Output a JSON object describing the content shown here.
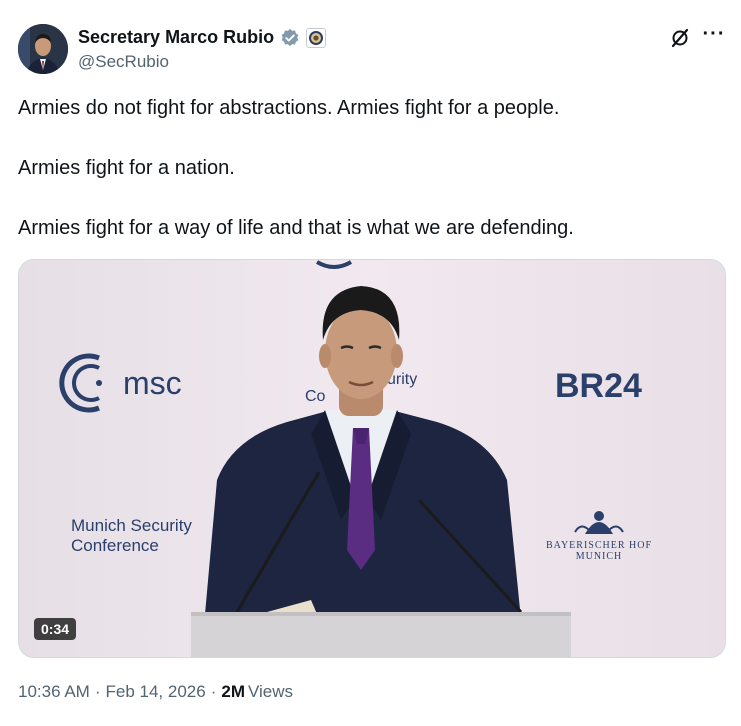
{
  "author": {
    "display_name": "Secretary Marco Rubio",
    "handle": "@SecRubio",
    "verified_icon": "verified-badge-icon",
    "affiliation_icon": "government-seal-icon"
  },
  "actions": {
    "grok_icon": "grok-icon",
    "more_label": "···"
  },
  "tweet": {
    "paragraphs": [
      "Armies do not fight for abstractions. Armies fight for a people.",
      "Armies fight for a nation.",
      "Armies fight for a way of life and that is what we are defending."
    ]
  },
  "media": {
    "type": "video",
    "duration": "0:34",
    "backdrop": {
      "logo_msc": "msc",
      "event_name_line1": "Munich Security",
      "event_name_line2": "Conference",
      "partial_text_1": "urity",
      "partial_text_2": "Co",
      "broadcaster": "BR24",
      "hotel_line1": "BAYERISCHER HOF",
      "hotel_line2": "MUNICH"
    },
    "colors": {
      "backdrop": "#ebe3ea",
      "logo_blue": "#2b3f6b",
      "suit": "#1d2540",
      "tie": "#5a2d82"
    }
  },
  "meta": {
    "time": "10:36 AM",
    "separator": "·",
    "date": "Feb 14, 2026",
    "views_count": "2M",
    "views_label": "Views"
  }
}
